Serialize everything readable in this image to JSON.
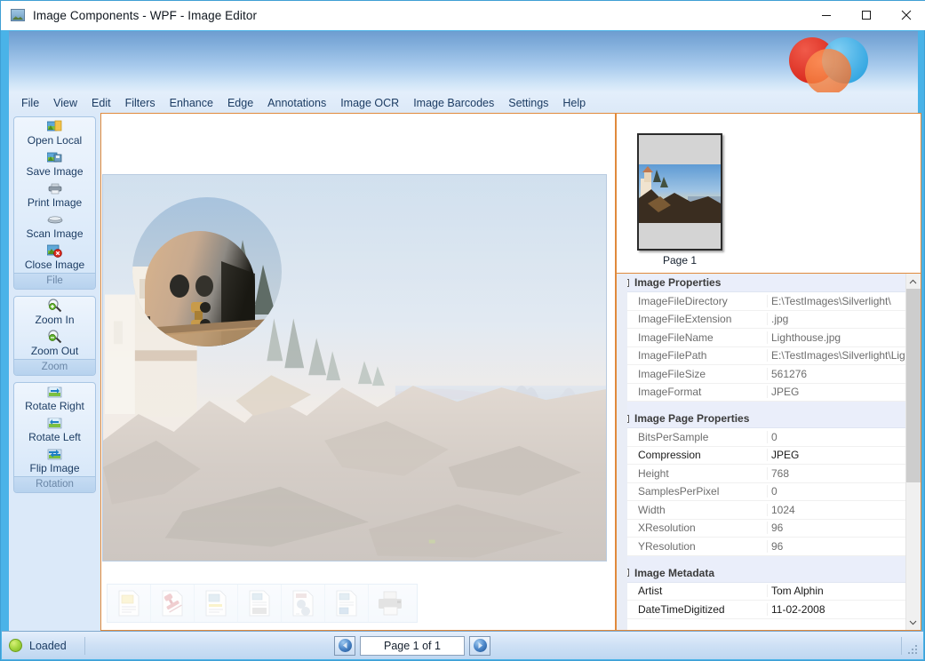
{
  "window": {
    "title": "Image Components - WPF - Image Editor",
    "icon": "picture-icon",
    "minimize_label": "Minimize",
    "maximize_label": "Maximize",
    "close_label": "Close"
  },
  "menubar": {
    "items": [
      {
        "label": "File"
      },
      {
        "label": "View"
      },
      {
        "label": "Edit"
      },
      {
        "label": "Filters"
      },
      {
        "label": "Enhance"
      },
      {
        "label": "Edge"
      },
      {
        "label": "Annotations"
      },
      {
        "label": "Image OCR"
      },
      {
        "label": "Image Barcodes"
      },
      {
        "label": "Settings"
      },
      {
        "label": "Help"
      }
    ]
  },
  "sidebar": {
    "groups": [
      {
        "caption": "File",
        "buttons": [
          {
            "label": "Open Local",
            "icon": "open-folder-image-icon"
          },
          {
            "label": "Save Image",
            "icon": "save-disk-image-icon"
          },
          {
            "label": "Print Image",
            "icon": "printer-icon"
          },
          {
            "label": "Scan Image",
            "icon": "scanner-icon"
          },
          {
            "label": "Close Image",
            "icon": "image-delete-icon"
          }
        ]
      },
      {
        "caption": "Zoom",
        "buttons": [
          {
            "label": "Zoom In",
            "icon": "magnifier-plus-icon"
          },
          {
            "label": "Zoom Out",
            "icon": "magnifier-minus-icon"
          }
        ]
      },
      {
        "caption": "Rotation",
        "buttons": [
          {
            "label": "Rotate Right",
            "icon": "rotate-right-icon"
          },
          {
            "label": "Rotate Left",
            "icon": "rotate-left-icon"
          },
          {
            "label": "Flip Image",
            "icon": "flip-image-icon"
          }
        ]
      }
    ]
  },
  "viewer": {
    "annotation_tools": [
      {
        "icon": "sticky-note-annotation-icon",
        "label": "Note Annotation"
      },
      {
        "icon": "stamp-annotation-icon",
        "label": "Stamp Annotation"
      },
      {
        "icon": "highlight-annotation-icon",
        "label": "Highlight Annotation"
      },
      {
        "icon": "redact-annotation-icon",
        "label": "Redact Annotation"
      },
      {
        "icon": "shape-annotation-icon",
        "label": "Shape Annotation"
      },
      {
        "icon": "image-annotation-icon",
        "label": "Image Annotation"
      },
      {
        "icon": "print-annotation-icon",
        "label": "Print"
      }
    ],
    "magnifier": {
      "visible": true,
      "shape": "circle"
    }
  },
  "thumbnails": {
    "pages": [
      {
        "label": "Page 1",
        "selected": true
      }
    ]
  },
  "properties": {
    "sections": [
      {
        "title": "Image Properties",
        "expanded": true,
        "rows": [
          {
            "key": "ImageFileDirectory",
            "value": "E:\\TestImages\\Silverlight\\",
            "highlighted": false
          },
          {
            "key": "ImageFileExtension",
            "value": ".jpg",
            "highlighted": false
          },
          {
            "key": "ImageFileName",
            "value": "Lighthouse.jpg",
            "highlighted": false
          },
          {
            "key": "ImageFilePath",
            "value": "E:\\TestImages\\Silverlight\\Lig",
            "highlighted": false
          },
          {
            "key": "ImageFileSize",
            "value": "561276",
            "highlighted": false
          },
          {
            "key": "ImageFormat",
            "value": "JPEG",
            "highlighted": false
          }
        ]
      },
      {
        "title": "Image Page Properties",
        "expanded": true,
        "rows": [
          {
            "key": "BitsPerSample",
            "value": "0",
            "highlighted": false
          },
          {
            "key": "Compression",
            "value": "JPEG",
            "highlighted": true
          },
          {
            "key": "Height",
            "value": "768",
            "highlighted": false
          },
          {
            "key": "SamplesPerPixel",
            "value": "0",
            "highlighted": false
          },
          {
            "key": "Width",
            "value": "1024",
            "highlighted": false
          },
          {
            "key": "XResolution",
            "value": "96",
            "highlighted": false
          },
          {
            "key": "YResolution",
            "value": "96",
            "highlighted": false
          }
        ]
      },
      {
        "title": "Image Metadata",
        "expanded": true,
        "rows": [
          {
            "key": "Artist",
            "value": "Tom Alphin",
            "highlighted": true
          },
          {
            "key": "DateTimeDigitized",
            "value": "11-02-2008",
            "highlighted": true
          }
        ]
      }
    ],
    "scrollbar": {
      "up_icon": "chevron-up-icon",
      "down_icon": "chevron-down-icon"
    }
  },
  "statusbar": {
    "state_label": "Loaded",
    "state_color": "#a8d944",
    "prev_page_icon": "arrow-left-orb-icon",
    "next_page_icon": "arrow-right-orb-icon",
    "page_indicator": "Page 1 of 1",
    "resize_grip_icon": "resize-grip-icon"
  },
  "colors": {
    "accent_frame": "#4ab3e8",
    "panel_border": "#e08a3c",
    "banner_top": "#6e9dd0",
    "menu_text": "#1c3c63"
  }
}
